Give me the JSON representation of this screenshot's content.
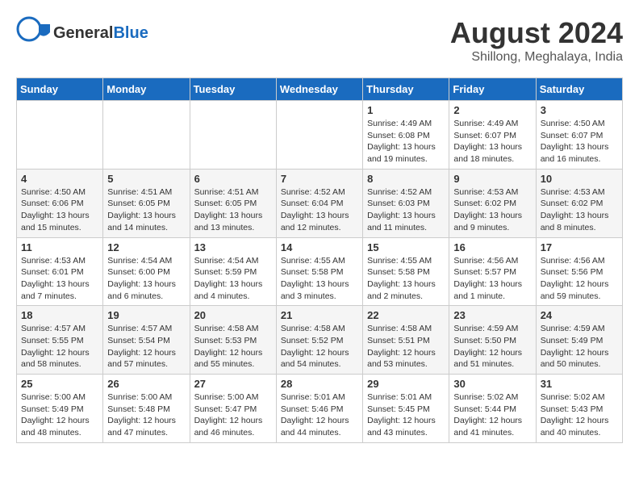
{
  "header": {
    "logo_general": "General",
    "logo_blue": "Blue",
    "month_year": "August 2024",
    "location": "Shillong, Meghalaya, India"
  },
  "days_of_week": [
    "Sunday",
    "Monday",
    "Tuesday",
    "Wednesday",
    "Thursday",
    "Friday",
    "Saturday"
  ],
  "weeks": [
    [
      {
        "day": "",
        "info": ""
      },
      {
        "day": "",
        "info": ""
      },
      {
        "day": "",
        "info": ""
      },
      {
        "day": "",
        "info": ""
      },
      {
        "day": "1",
        "info": "Sunrise: 4:49 AM\nSunset: 6:08 PM\nDaylight: 13 hours\nand 19 minutes."
      },
      {
        "day": "2",
        "info": "Sunrise: 4:49 AM\nSunset: 6:07 PM\nDaylight: 13 hours\nand 18 minutes."
      },
      {
        "day": "3",
        "info": "Sunrise: 4:50 AM\nSunset: 6:07 PM\nDaylight: 13 hours\nand 16 minutes."
      }
    ],
    [
      {
        "day": "4",
        "info": "Sunrise: 4:50 AM\nSunset: 6:06 PM\nDaylight: 13 hours\nand 15 minutes."
      },
      {
        "day": "5",
        "info": "Sunrise: 4:51 AM\nSunset: 6:05 PM\nDaylight: 13 hours\nand 14 minutes."
      },
      {
        "day": "6",
        "info": "Sunrise: 4:51 AM\nSunset: 6:05 PM\nDaylight: 13 hours\nand 13 minutes."
      },
      {
        "day": "7",
        "info": "Sunrise: 4:52 AM\nSunset: 6:04 PM\nDaylight: 13 hours\nand 12 minutes."
      },
      {
        "day": "8",
        "info": "Sunrise: 4:52 AM\nSunset: 6:03 PM\nDaylight: 13 hours\nand 11 minutes."
      },
      {
        "day": "9",
        "info": "Sunrise: 4:53 AM\nSunset: 6:02 PM\nDaylight: 13 hours\nand 9 minutes."
      },
      {
        "day": "10",
        "info": "Sunrise: 4:53 AM\nSunset: 6:02 PM\nDaylight: 13 hours\nand 8 minutes."
      }
    ],
    [
      {
        "day": "11",
        "info": "Sunrise: 4:53 AM\nSunset: 6:01 PM\nDaylight: 13 hours\nand 7 minutes."
      },
      {
        "day": "12",
        "info": "Sunrise: 4:54 AM\nSunset: 6:00 PM\nDaylight: 13 hours\nand 6 minutes."
      },
      {
        "day": "13",
        "info": "Sunrise: 4:54 AM\nSunset: 5:59 PM\nDaylight: 13 hours\nand 4 minutes."
      },
      {
        "day": "14",
        "info": "Sunrise: 4:55 AM\nSunset: 5:58 PM\nDaylight: 13 hours\nand 3 minutes."
      },
      {
        "day": "15",
        "info": "Sunrise: 4:55 AM\nSunset: 5:58 PM\nDaylight: 13 hours\nand 2 minutes."
      },
      {
        "day": "16",
        "info": "Sunrise: 4:56 AM\nSunset: 5:57 PM\nDaylight: 13 hours\nand 1 minute."
      },
      {
        "day": "17",
        "info": "Sunrise: 4:56 AM\nSunset: 5:56 PM\nDaylight: 12 hours\nand 59 minutes."
      }
    ],
    [
      {
        "day": "18",
        "info": "Sunrise: 4:57 AM\nSunset: 5:55 PM\nDaylight: 12 hours\nand 58 minutes."
      },
      {
        "day": "19",
        "info": "Sunrise: 4:57 AM\nSunset: 5:54 PM\nDaylight: 12 hours\nand 57 minutes."
      },
      {
        "day": "20",
        "info": "Sunrise: 4:58 AM\nSunset: 5:53 PM\nDaylight: 12 hours\nand 55 minutes."
      },
      {
        "day": "21",
        "info": "Sunrise: 4:58 AM\nSunset: 5:52 PM\nDaylight: 12 hours\nand 54 minutes."
      },
      {
        "day": "22",
        "info": "Sunrise: 4:58 AM\nSunset: 5:51 PM\nDaylight: 12 hours\nand 53 minutes."
      },
      {
        "day": "23",
        "info": "Sunrise: 4:59 AM\nSunset: 5:50 PM\nDaylight: 12 hours\nand 51 minutes."
      },
      {
        "day": "24",
        "info": "Sunrise: 4:59 AM\nSunset: 5:49 PM\nDaylight: 12 hours\nand 50 minutes."
      }
    ],
    [
      {
        "day": "25",
        "info": "Sunrise: 5:00 AM\nSunset: 5:49 PM\nDaylight: 12 hours\nand 48 minutes."
      },
      {
        "day": "26",
        "info": "Sunrise: 5:00 AM\nSunset: 5:48 PM\nDaylight: 12 hours\nand 47 minutes."
      },
      {
        "day": "27",
        "info": "Sunrise: 5:00 AM\nSunset: 5:47 PM\nDaylight: 12 hours\nand 46 minutes."
      },
      {
        "day": "28",
        "info": "Sunrise: 5:01 AM\nSunset: 5:46 PM\nDaylight: 12 hours\nand 44 minutes."
      },
      {
        "day": "29",
        "info": "Sunrise: 5:01 AM\nSunset: 5:45 PM\nDaylight: 12 hours\nand 43 minutes."
      },
      {
        "day": "30",
        "info": "Sunrise: 5:02 AM\nSunset: 5:44 PM\nDaylight: 12 hours\nand 41 minutes."
      },
      {
        "day": "31",
        "info": "Sunrise: 5:02 AM\nSunset: 5:43 PM\nDaylight: 12 hours\nand 40 minutes."
      }
    ]
  ]
}
